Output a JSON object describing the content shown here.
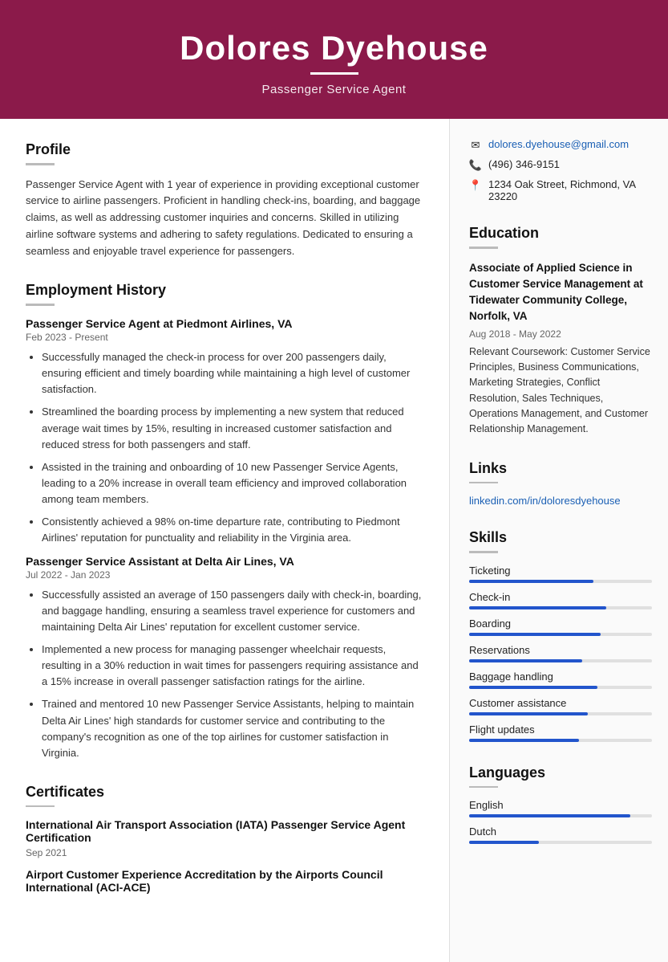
{
  "header": {
    "name": "Dolores Dyehouse",
    "subtitle": "Passenger Service Agent",
    "underline": true
  },
  "contact": {
    "email": "dolores.dyehouse@gmail.com",
    "phone": "(496) 346-9151",
    "address": "1234 Oak Street, Richmond, VA 23220"
  },
  "profile": {
    "section_title": "Profile",
    "text": "Passenger Service Agent with 1 year of experience in providing exceptional customer service to airline passengers. Proficient in handling check-ins, boarding, and baggage claims, as well as addressing customer inquiries and concerns. Skilled in utilizing airline software systems and adhering to safety regulations. Dedicated to ensuring a seamless and enjoyable travel experience for passengers."
  },
  "employment": {
    "section_title": "Employment History",
    "jobs": [
      {
        "title": "Passenger Service Agent at Piedmont Airlines, VA",
        "dates": "Feb 2023 - Present",
        "bullets": [
          "Successfully managed the check-in process for over 200 passengers daily, ensuring efficient and timely boarding while maintaining a high level of customer satisfaction.",
          "Streamlined the boarding process by implementing a new system that reduced average wait times by 15%, resulting in increased customer satisfaction and reduced stress for both passengers and staff.",
          "Assisted in the training and onboarding of 10 new Passenger Service Agents, leading to a 20% increase in overall team efficiency and improved collaboration among team members.",
          "Consistently achieved a 98% on-time departure rate, contributing to Piedmont Airlines' reputation for punctuality and reliability in the Virginia area."
        ]
      },
      {
        "title": "Passenger Service Assistant at Delta Air Lines, VA",
        "dates": "Jul 2022 - Jan 2023",
        "bullets": [
          "Successfully assisted an average of 150 passengers daily with check-in, boarding, and baggage handling, ensuring a seamless travel experience for customers and maintaining Delta Air Lines' reputation for excellent customer service.",
          "Implemented a new process for managing passenger wheelchair requests, resulting in a 30% reduction in wait times for passengers requiring assistance and a 15% increase in overall passenger satisfaction ratings for the airline.",
          "Trained and mentored 10 new Passenger Service Assistants, helping to maintain Delta Air Lines' high standards for customer service and contributing to the company's recognition as one of the top airlines for customer satisfaction in Virginia."
        ]
      }
    ]
  },
  "certificates": {
    "section_title": "Certificates",
    "items": [
      {
        "title": "International Air Transport Association (IATA) Passenger Service Agent Certification",
        "date": "Sep 2021"
      },
      {
        "title": "Airport Customer Experience Accreditation by the Airports Council International (ACI-ACE)",
        "date": ""
      }
    ]
  },
  "education": {
    "section_title": "Education",
    "items": [
      {
        "title": "Associate of Applied Science in Customer Service Management at Tidewater Community College, Norfolk, VA",
        "dates": "Aug 2018 - May 2022",
        "coursework": "Relevant Coursework: Customer Service Principles, Business Communications, Marketing Strategies, Conflict Resolution, Sales Techniques, Operations Management, and Customer Relationship Management."
      }
    ]
  },
  "links": {
    "section_title": "Links",
    "items": [
      {
        "label": "linkedin.com/in/doloresdyehouse",
        "url": "linkedin.com/in/doloresdyehouse"
      }
    ]
  },
  "skills": {
    "section_title": "Skills",
    "items": [
      {
        "label": "Ticketing",
        "pct": 68
      },
      {
        "label": "Check-in",
        "pct": 75
      },
      {
        "label": "Boarding",
        "pct": 72
      },
      {
        "label": "Reservations",
        "pct": 62
      },
      {
        "label": "Baggage handling",
        "pct": 70
      },
      {
        "label": "Customer assistance",
        "pct": 65
      },
      {
        "label": "Flight updates",
        "pct": 60
      }
    ]
  },
  "languages": {
    "section_title": "Languages",
    "items": [
      {
        "label": "English",
        "pct": 88
      },
      {
        "label": "Dutch",
        "pct": 38
      }
    ]
  }
}
